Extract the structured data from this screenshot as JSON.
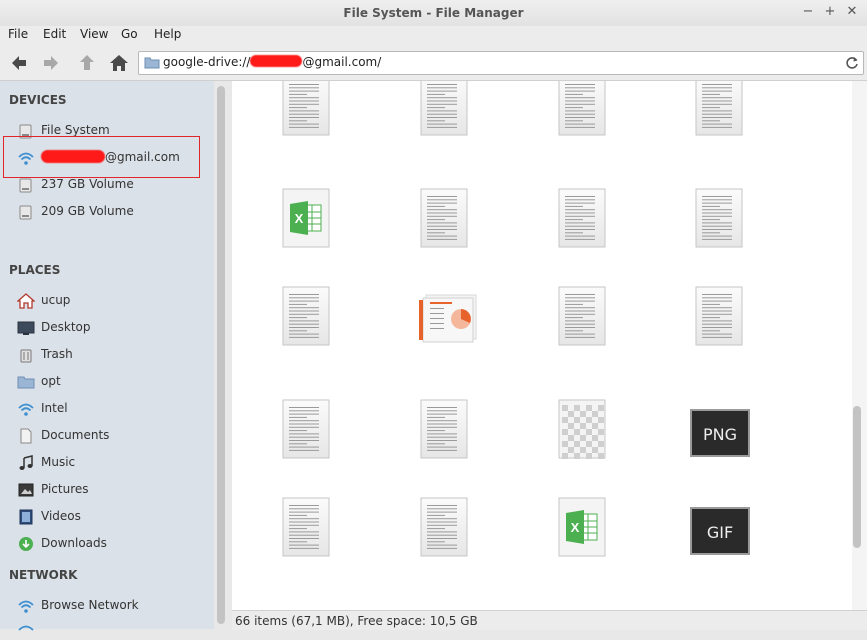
{
  "window": {
    "title": "File System - File Manager",
    "minimize": "−",
    "maximize": "+",
    "close": "✕"
  },
  "menu": [
    "File",
    "Edit",
    "View",
    "Go",
    "Help"
  ],
  "location": {
    "prefix": "google-drive://",
    "suffix": "@gmail.com/"
  },
  "sidebar": {
    "devices_header": "DEVICES",
    "devices": [
      {
        "label": "File System",
        "icon": "drive-icon"
      },
      {
        "label": "@gmail.com",
        "icon": "network-icon"
      },
      {
        "label": "237 GB Volume",
        "icon": "drive-icon"
      },
      {
        "label": "209 GB Volume",
        "icon": "drive-icon"
      }
    ],
    "places_header": "PLACES",
    "places": [
      {
        "label": "ucup",
        "icon": "home-icon"
      },
      {
        "label": "Desktop",
        "icon": "desktop-icon"
      },
      {
        "label": "Trash",
        "icon": "trash-icon"
      },
      {
        "label": "opt",
        "icon": "folder-icon"
      },
      {
        "label": "Intel",
        "icon": "network-icon"
      },
      {
        "label": "Documents",
        "icon": "document-icon"
      },
      {
        "label": "Music",
        "icon": "music-icon"
      },
      {
        "label": "Pictures",
        "icon": "pictures-icon"
      },
      {
        "label": "Videos",
        "icon": "videos-icon"
      },
      {
        "label": "Downloads",
        "icon": "downloads-icon"
      }
    ],
    "network_header": "NETWORK",
    "network": [
      {
        "label": "Browse Network",
        "icon": "network-icon"
      }
    ]
  },
  "files": [
    {
      "type": "doc"
    },
    {
      "type": "doc"
    },
    {
      "type": "doc"
    },
    {
      "type": "doc"
    },
    {
      "type": "xls"
    },
    {
      "type": "doc"
    },
    {
      "type": "doc"
    },
    {
      "type": "doc"
    },
    {
      "type": "doc"
    },
    {
      "type": "ppt"
    },
    {
      "type": "doc"
    },
    {
      "type": "doc"
    },
    {
      "type": "doc"
    },
    {
      "type": "doc"
    },
    {
      "type": "img"
    },
    {
      "type": "png",
      "label": "PNG"
    },
    {
      "type": "doc"
    },
    {
      "type": "doc"
    },
    {
      "type": "xls"
    },
    {
      "type": "gif",
      "label": "GIF"
    }
  ],
  "status": "66 items (67,1 MB), Free space: 10,5 GB",
  "colors": {
    "accent": "#3d8fd1",
    "highlight_box": "#e0262a",
    "sidebar_bg": "#dbe1e8",
    "excel_green": "#4caf50",
    "ppt_orange": "#e8622c"
  }
}
